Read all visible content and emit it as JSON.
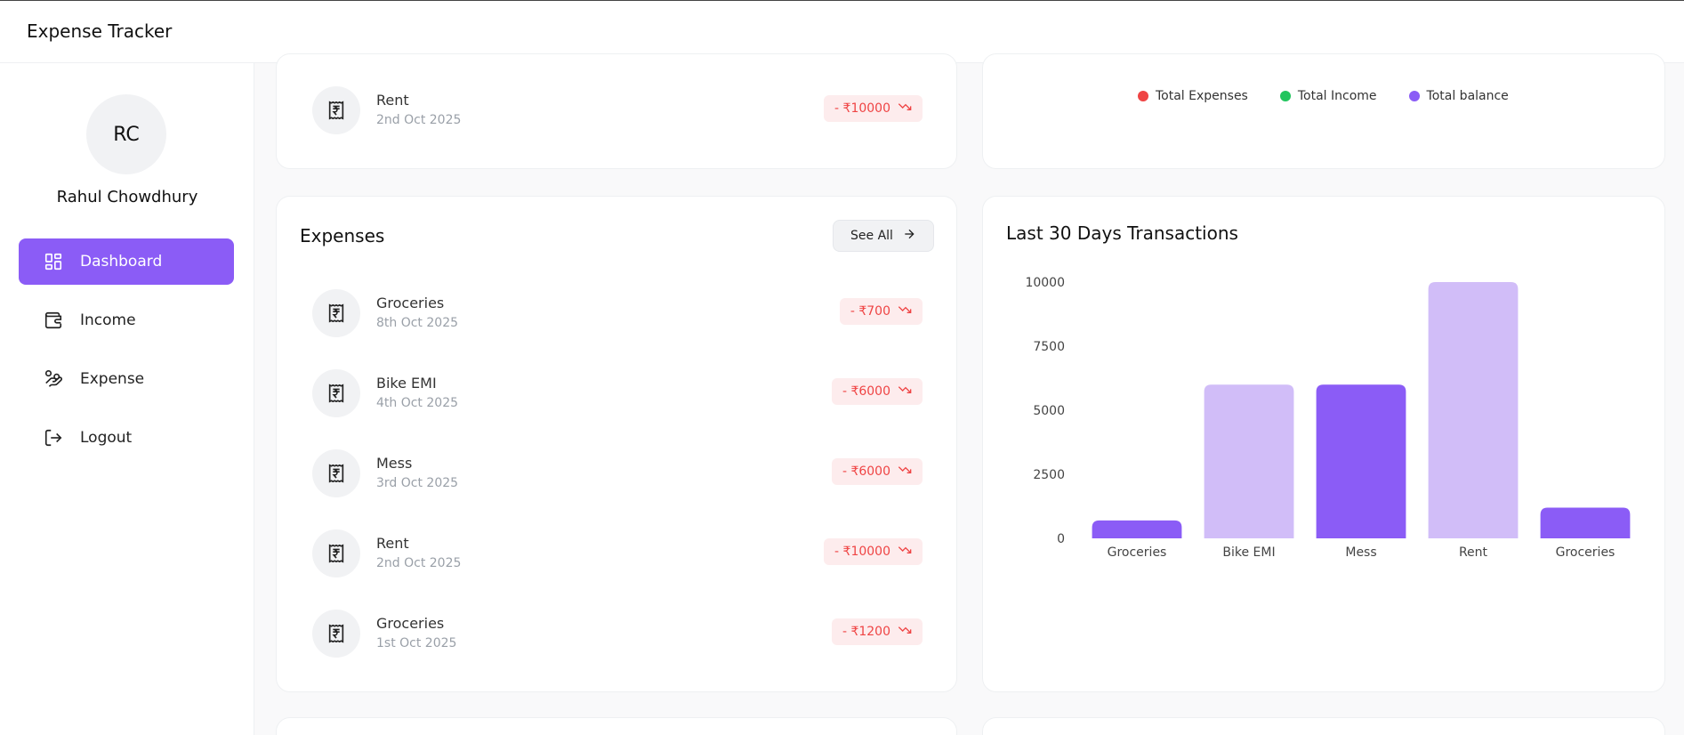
{
  "app": {
    "title": "Expense Tracker"
  },
  "user": {
    "initials": "RC",
    "name": "Rahul Chowdhury"
  },
  "nav": [
    {
      "label": "Dashboard",
      "icon": "dashboard-icon",
      "active": true
    },
    {
      "label": "Income",
      "icon": "wallet-icon",
      "active": false
    },
    {
      "label": "Expense",
      "icon": "hand-coins-icon",
      "active": false
    },
    {
      "label": "Logout",
      "icon": "logout-icon",
      "active": false
    }
  ],
  "top_transaction": {
    "name": "Rent",
    "date": "2nd Oct 2025",
    "amount": "- ₹10000"
  },
  "legend": [
    {
      "label": "Total Expenses",
      "color": "#ef4444"
    },
    {
      "label": "Total Income",
      "color": "#22c55e"
    },
    {
      "label": "Total balance",
      "color": "#8b5cf6"
    }
  ],
  "expenses": {
    "title": "Expenses",
    "see_all_label": "See All",
    "items": [
      {
        "name": "Groceries",
        "date": "8th Oct 2025",
        "amount": "- ₹700"
      },
      {
        "name": "Bike EMI",
        "date": "4th Oct 2025",
        "amount": "- ₹6000"
      },
      {
        "name": "Mess",
        "date": "3rd Oct 2025",
        "amount": "- ₹6000"
      },
      {
        "name": "Rent",
        "date": "2nd Oct 2025",
        "amount": "- ₹10000"
      },
      {
        "name": "Groceries",
        "date": "1st Oct 2025",
        "amount": "- ₹1200"
      }
    ]
  },
  "chart_data": {
    "type": "bar",
    "title": "Last 30 Days Transactions",
    "categories": [
      "Groceries",
      "Bike EMI",
      "Mess",
      "Rent",
      "Groceries"
    ],
    "values": [
      700,
      6000,
      6000,
      10000,
      1200
    ],
    "colors": [
      "#8b5cf6",
      "#d1bdf8",
      "#8b5cf6",
      "#d1bdf8",
      "#8b5cf6"
    ],
    "yticks": [
      0,
      2500,
      5000,
      7500,
      10000
    ],
    "ylim": [
      0,
      10000
    ],
    "xlabel": "",
    "ylabel": "",
    "grid": false
  },
  "colors": {
    "accent": "#8b5cf6",
    "expense_red": "#ef4444",
    "badge_bg": "#fdeced"
  }
}
